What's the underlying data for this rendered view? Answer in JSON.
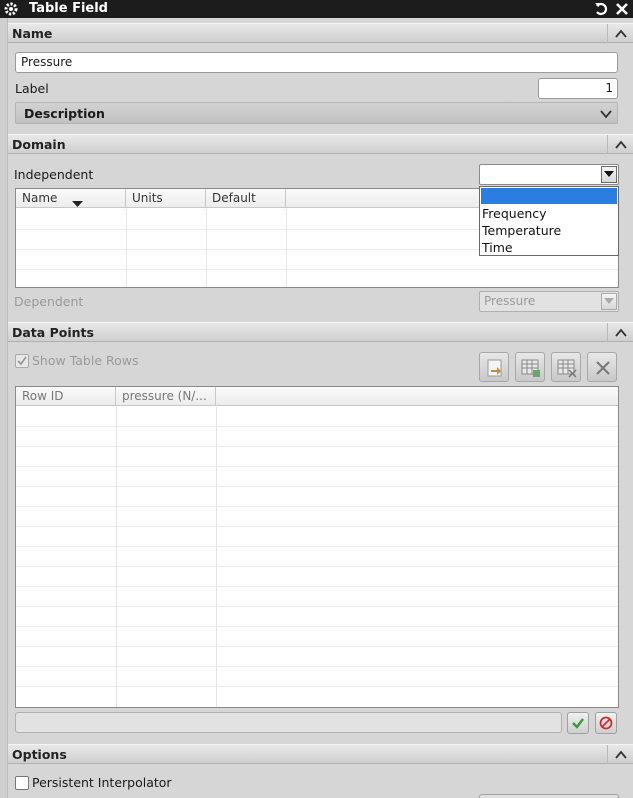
{
  "window": {
    "title": "Table Field"
  },
  "sections": {
    "name": {
      "header": "Name",
      "name_value": "Pressure",
      "label_caption": "Label",
      "label_value": "1",
      "description_header": "Description"
    },
    "domain": {
      "header": "Domain",
      "independent_caption": "Independent",
      "independent_value": "",
      "table_columns": [
        "Name",
        "Units",
        "Default"
      ],
      "dropdown_options": [
        "",
        "Frequency",
        "Temperature",
        "Time"
      ],
      "dependent_caption": "Dependent",
      "dependent_value": "Pressure"
    },
    "data_points": {
      "header": "Data Points",
      "show_table_rows_label": "Show Table Rows",
      "show_table_rows_checked": true,
      "table_columns": [
        "Row ID",
        "pressure (N/..."
      ]
    },
    "options": {
      "header": "Options",
      "persistent_interpolator_label": "Persistent Interpolator",
      "persistent_interpolator_checked": false
    }
  },
  "colors": {
    "titlebar_bg": "#1c1c1c",
    "panel_bg": "#d6d6d6",
    "accept_green": "#3a9a3a",
    "cancel_red": "#c83030"
  },
  "icons": [
    "gear-icon",
    "reset-icon",
    "close-icon",
    "chevron-up-icon",
    "chevron-down-icon",
    "sort-down-icon",
    "dropdown-arrow-icon",
    "insert-row-icon",
    "add-table-icon",
    "remove-table-icon",
    "delete-icon",
    "checkmark-icon",
    "no-entry-icon"
  ]
}
